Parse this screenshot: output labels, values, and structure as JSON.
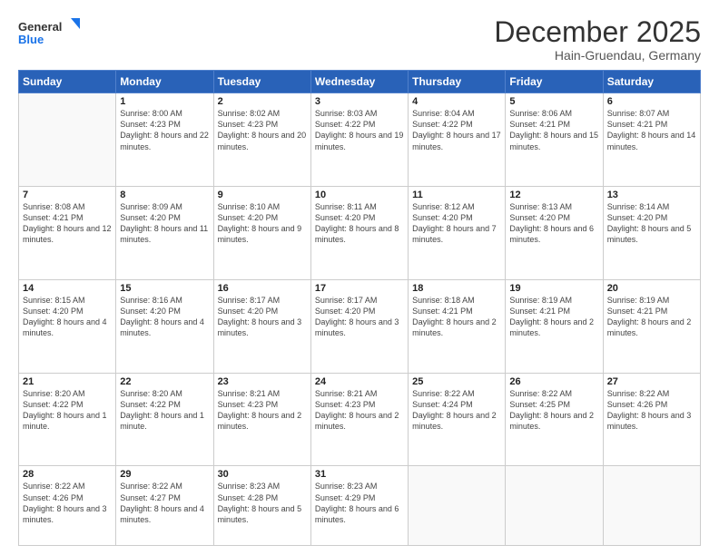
{
  "header": {
    "logo_line1": "General",
    "logo_line2": "Blue",
    "month": "December 2025",
    "location": "Hain-Gruendau, Germany"
  },
  "weekdays": [
    "Sunday",
    "Monday",
    "Tuesday",
    "Wednesday",
    "Thursday",
    "Friday",
    "Saturday"
  ],
  "weeks": [
    [
      {
        "day": "",
        "sunrise": "",
        "sunset": "",
        "daylight": ""
      },
      {
        "day": "1",
        "sunrise": "Sunrise: 8:00 AM",
        "sunset": "Sunset: 4:23 PM",
        "daylight": "Daylight: 8 hours and 22 minutes."
      },
      {
        "day": "2",
        "sunrise": "Sunrise: 8:02 AM",
        "sunset": "Sunset: 4:23 PM",
        "daylight": "Daylight: 8 hours and 20 minutes."
      },
      {
        "day": "3",
        "sunrise": "Sunrise: 8:03 AM",
        "sunset": "Sunset: 4:22 PM",
        "daylight": "Daylight: 8 hours and 19 minutes."
      },
      {
        "day": "4",
        "sunrise": "Sunrise: 8:04 AM",
        "sunset": "Sunset: 4:22 PM",
        "daylight": "Daylight: 8 hours and 17 minutes."
      },
      {
        "day": "5",
        "sunrise": "Sunrise: 8:06 AM",
        "sunset": "Sunset: 4:21 PM",
        "daylight": "Daylight: 8 hours and 15 minutes."
      },
      {
        "day": "6",
        "sunrise": "Sunrise: 8:07 AM",
        "sunset": "Sunset: 4:21 PM",
        "daylight": "Daylight: 8 hours and 14 minutes."
      }
    ],
    [
      {
        "day": "7",
        "sunrise": "Sunrise: 8:08 AM",
        "sunset": "Sunset: 4:21 PM",
        "daylight": "Daylight: 8 hours and 12 minutes."
      },
      {
        "day": "8",
        "sunrise": "Sunrise: 8:09 AM",
        "sunset": "Sunset: 4:20 PM",
        "daylight": "Daylight: 8 hours and 11 minutes."
      },
      {
        "day": "9",
        "sunrise": "Sunrise: 8:10 AM",
        "sunset": "Sunset: 4:20 PM",
        "daylight": "Daylight: 8 hours and 9 minutes."
      },
      {
        "day": "10",
        "sunrise": "Sunrise: 8:11 AM",
        "sunset": "Sunset: 4:20 PM",
        "daylight": "Daylight: 8 hours and 8 minutes."
      },
      {
        "day": "11",
        "sunrise": "Sunrise: 8:12 AM",
        "sunset": "Sunset: 4:20 PM",
        "daylight": "Daylight: 8 hours and 7 minutes."
      },
      {
        "day": "12",
        "sunrise": "Sunrise: 8:13 AM",
        "sunset": "Sunset: 4:20 PM",
        "daylight": "Daylight: 8 hours and 6 minutes."
      },
      {
        "day": "13",
        "sunrise": "Sunrise: 8:14 AM",
        "sunset": "Sunset: 4:20 PM",
        "daylight": "Daylight: 8 hours and 5 minutes."
      }
    ],
    [
      {
        "day": "14",
        "sunrise": "Sunrise: 8:15 AM",
        "sunset": "Sunset: 4:20 PM",
        "daylight": "Daylight: 8 hours and 4 minutes."
      },
      {
        "day": "15",
        "sunrise": "Sunrise: 8:16 AM",
        "sunset": "Sunset: 4:20 PM",
        "daylight": "Daylight: 8 hours and 4 minutes."
      },
      {
        "day": "16",
        "sunrise": "Sunrise: 8:17 AM",
        "sunset": "Sunset: 4:20 PM",
        "daylight": "Daylight: 8 hours and 3 minutes."
      },
      {
        "day": "17",
        "sunrise": "Sunrise: 8:17 AM",
        "sunset": "Sunset: 4:20 PM",
        "daylight": "Daylight: 8 hours and 3 minutes."
      },
      {
        "day": "18",
        "sunrise": "Sunrise: 8:18 AM",
        "sunset": "Sunset: 4:21 PM",
        "daylight": "Daylight: 8 hours and 2 minutes."
      },
      {
        "day": "19",
        "sunrise": "Sunrise: 8:19 AM",
        "sunset": "Sunset: 4:21 PM",
        "daylight": "Daylight: 8 hours and 2 minutes."
      },
      {
        "day": "20",
        "sunrise": "Sunrise: 8:19 AM",
        "sunset": "Sunset: 4:21 PM",
        "daylight": "Daylight: 8 hours and 2 minutes."
      }
    ],
    [
      {
        "day": "21",
        "sunrise": "Sunrise: 8:20 AM",
        "sunset": "Sunset: 4:22 PM",
        "daylight": "Daylight: 8 hours and 1 minute."
      },
      {
        "day": "22",
        "sunrise": "Sunrise: 8:20 AM",
        "sunset": "Sunset: 4:22 PM",
        "daylight": "Daylight: 8 hours and 1 minute."
      },
      {
        "day": "23",
        "sunrise": "Sunrise: 8:21 AM",
        "sunset": "Sunset: 4:23 PM",
        "daylight": "Daylight: 8 hours and 2 minutes."
      },
      {
        "day": "24",
        "sunrise": "Sunrise: 8:21 AM",
        "sunset": "Sunset: 4:23 PM",
        "daylight": "Daylight: 8 hours and 2 minutes."
      },
      {
        "day": "25",
        "sunrise": "Sunrise: 8:22 AM",
        "sunset": "Sunset: 4:24 PM",
        "daylight": "Daylight: 8 hours and 2 minutes."
      },
      {
        "day": "26",
        "sunrise": "Sunrise: 8:22 AM",
        "sunset": "Sunset: 4:25 PM",
        "daylight": "Daylight: 8 hours and 2 minutes."
      },
      {
        "day": "27",
        "sunrise": "Sunrise: 8:22 AM",
        "sunset": "Sunset: 4:26 PM",
        "daylight": "Daylight: 8 hours and 3 minutes."
      }
    ],
    [
      {
        "day": "28",
        "sunrise": "Sunrise: 8:22 AM",
        "sunset": "Sunset: 4:26 PM",
        "daylight": "Daylight: 8 hours and 3 minutes."
      },
      {
        "day": "29",
        "sunrise": "Sunrise: 8:22 AM",
        "sunset": "Sunset: 4:27 PM",
        "daylight": "Daylight: 8 hours and 4 minutes."
      },
      {
        "day": "30",
        "sunrise": "Sunrise: 8:23 AM",
        "sunset": "Sunset: 4:28 PM",
        "daylight": "Daylight: 8 hours and 5 minutes."
      },
      {
        "day": "31",
        "sunrise": "Sunrise: 8:23 AM",
        "sunset": "Sunset: 4:29 PM",
        "daylight": "Daylight: 8 hours and 6 minutes."
      },
      {
        "day": "",
        "sunrise": "",
        "sunset": "",
        "daylight": ""
      },
      {
        "day": "",
        "sunrise": "",
        "sunset": "",
        "daylight": ""
      },
      {
        "day": "",
        "sunrise": "",
        "sunset": "",
        "daylight": ""
      }
    ]
  ]
}
